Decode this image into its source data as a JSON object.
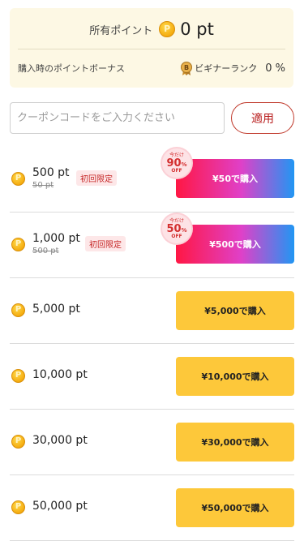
{
  "summary": {
    "points_label": "所有ポイント",
    "points_value": "0 pt",
    "bonus_label": "購入時のポイントボーナス",
    "rank_letter": "B",
    "rank_name": "ビギナーランク",
    "rank_percent": "0 %"
  },
  "coupon": {
    "placeholder": "クーポンコードをご入力ください",
    "value": "",
    "apply_label": "適用"
  },
  "packages": [
    {
      "amount": "500 pt",
      "original": "50 pt",
      "tag": "初回限定",
      "badge_top": "今だけ",
      "badge_pct": "90",
      "badge_pct_sign": "%",
      "badge_off": "OFF",
      "button": "¥50で購入"
    },
    {
      "amount": "1,000 pt",
      "original": "500 pt",
      "tag": "初回限定",
      "badge_top": "今だけ",
      "badge_pct": "50",
      "badge_pct_sign": "%",
      "badge_off": "OFF",
      "button": "¥500で購入"
    },
    {
      "amount": "5,000 pt",
      "button": "¥5,000で購入"
    },
    {
      "amount": "10,000 pt",
      "button": "¥10,000で購入"
    },
    {
      "amount": "30,000 pt",
      "button": "¥30,000で購入"
    },
    {
      "amount": "50,000 pt",
      "button": "¥50,000で購入"
    }
  ],
  "colors": {
    "summary_bg": "#fdf8e4",
    "apply_border": "#c0392b",
    "buy_gold": "#fdc83a",
    "buy_gradient_start": "#ff1744",
    "buy_gradient_end": "#2196f3"
  },
  "icons": {
    "coin": "coin-icon",
    "rank": "rank-badge-icon"
  }
}
